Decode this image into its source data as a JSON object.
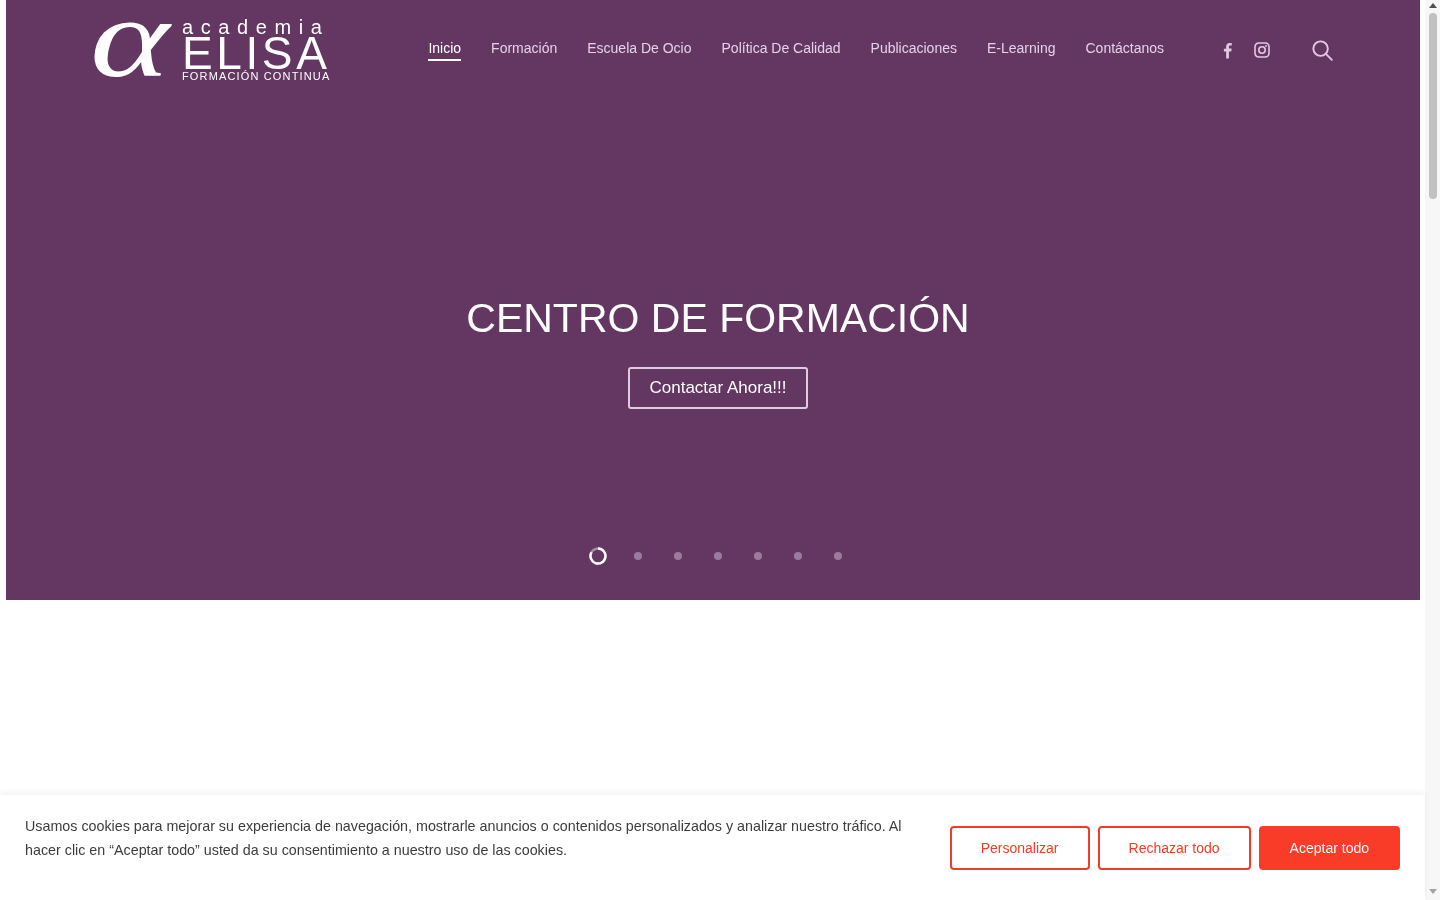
{
  "header": {
    "logo": {
      "mark": "α",
      "top_word": "academia",
      "name": "ELISA",
      "tagline": "FORMACIÓN CONTINUA"
    },
    "nav": [
      {
        "label": "Inicio",
        "selected": true
      },
      {
        "label": "Formación",
        "selected": false
      },
      {
        "label": "Escuela De Ocio",
        "selected": false
      },
      {
        "label": "Política De Calidad",
        "selected": false
      },
      {
        "label": "Publicaciones",
        "selected": false
      },
      {
        "label": "E-Learning",
        "selected": false
      },
      {
        "label": "Contáctanos",
        "selected": false
      }
    ]
  },
  "hero": {
    "title": "CENTRO DE FORMACIÓN",
    "button": "Contactar Ahora!!!",
    "slides": [
      {
        "selected": true
      },
      {
        "selected": false
      },
      {
        "selected": false
      },
      {
        "selected": false
      },
      {
        "selected": false
      },
      {
        "selected": false
      },
      {
        "selected": false
      }
    ]
  },
  "cookie_banner": {
    "text": "Usamos cookies para mejorar su experiencia de navegación, mostrarle anuncios o contenidos personalizados y analizar nuestro tráfico. Al hacer clic en “Aceptar todo” usted da su consentimiento a nuestro uso de las cookies.",
    "buttons": [
      {
        "label": "Personalizar",
        "kind": "outline"
      },
      {
        "label": "Rechazar todo",
        "kind": "outline"
      },
      {
        "label": "Aceptar todo",
        "kind": "filled"
      }
    ]
  }
}
